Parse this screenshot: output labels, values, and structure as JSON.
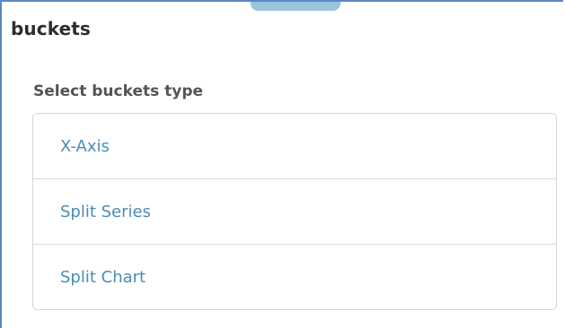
{
  "panel": {
    "title": "buckets",
    "subtitle": "Select buckets type"
  },
  "bucket_types": [
    {
      "label": "X-Axis"
    },
    {
      "label": "Split Series"
    },
    {
      "label": "Split Chart"
    }
  ],
  "colors": {
    "frame_border": "#5b86c5",
    "drag_tab": "#9cc3dc",
    "link_text": "#4c8cb5",
    "title_text": "#2d2d2d",
    "subtitle_text": "#545454",
    "list_border": "#d6d6d6"
  }
}
